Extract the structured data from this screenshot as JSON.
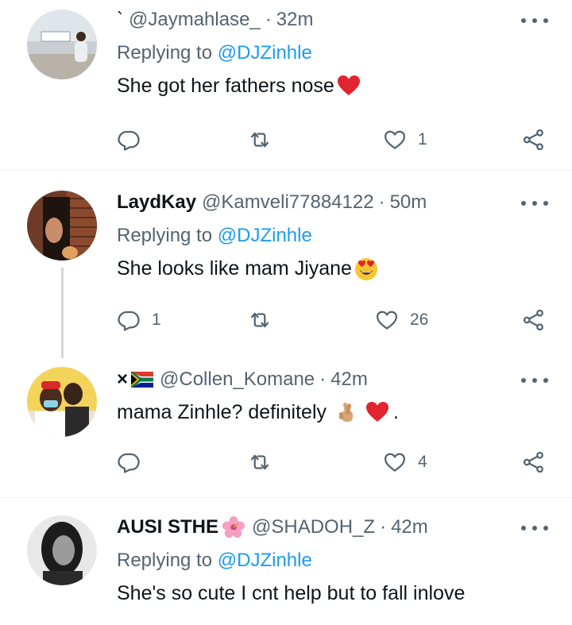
{
  "tweets": [
    {
      "display_name": "`",
      "handle": "@Jaymahlase_",
      "time": "32m",
      "reply_prefix": "Replying to",
      "reply_to": "@DJZinhle",
      "text": "She got her fathers nose",
      "emoji": [
        "red-heart"
      ],
      "reply_count": "",
      "retweet_count": "",
      "like_count": "1"
    },
    {
      "display_name": "LaydKay",
      "handle": "@Kamveli77884122",
      "time": "50m",
      "reply_prefix": "Replying to",
      "reply_to": "@DJZinhle",
      "text": "She looks like mam Jiyane",
      "emoji": [
        "heart-eyes-face"
      ],
      "reply_count": "1",
      "retweet_count": "",
      "like_count": "26"
    },
    {
      "display_name": "×",
      "handle": "@Collen_Komane",
      "time": "42m",
      "reply_prefix": "",
      "reply_to": "",
      "text": "mama Zinhle? definitely",
      "text_suffix": ".",
      "emoji": [
        "crossed-fingers",
        "red-heart"
      ],
      "reply_count": "",
      "retweet_count": "",
      "like_count": "4"
    },
    {
      "display_name": "AUSI STHE",
      "handle": "@SHADOH_Z",
      "time": "42m",
      "reply_prefix": "Replying to",
      "reply_to": "@DJZinhle",
      "text": "She's so cute I cnt help but to fall inlove"
    }
  ],
  "separator": "·",
  "colors": {
    "accent": "#1d9bf0",
    "muted": "#536471",
    "text": "#0f1419",
    "divider": "#eff3f4",
    "heart": "#f4212e"
  },
  "icons": [
    "reply-icon",
    "retweet-icon",
    "like-icon",
    "share-icon",
    "more-icon"
  ]
}
